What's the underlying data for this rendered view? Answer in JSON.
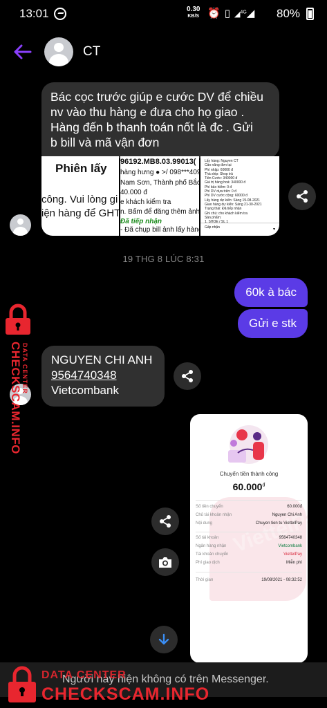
{
  "status_bar": {
    "time": "13:01",
    "net_speed_value": "0.30",
    "net_speed_unit": "KB/S",
    "signal_label": "4G",
    "battery": "80%"
  },
  "header": {
    "contact_name": "CT"
  },
  "messages": {
    "incoming_1": "Bác cọc trước giúp e cước DV để chiều\nnv vào thu hàng e đưa cho họ giao .\nHàng đến b thanh toán nốt là đc . Gửi\nb bill và mã vận đơn",
    "thumb1": {
      "title": "Phiên lấy",
      "line1": "công. Vui lòng gi",
      "line2": "iện hàng để GHT"
    },
    "thumb2": {
      "lines": [
        "96192.MB8.03.99013(",
        "hàng hưng ● >/ 098***4090",
        "Nam Sơn, Thành phố Bắc Nin",
        "40.000 đ",
        "e khách kiểm tra",
        "n. Bấm để đăng thêm ảnh!!!",
        "Đã tiếp nhận",
        "- Đã chụp bill ảnh lấy hàng."
      ]
    },
    "thumb3": {
      "text": "Lấy hàng: Nguyen CT\nCần nâng đơn tại\nPhí nhập: 60000 đ\nThà ship: Shop trả\nTiền Cước: 340000 đ\nGiá trị hàng hoá: 340000 đ\nPhí bảo hiểm: 0 đ\nPhí DV dựa trên: 0 đ\nPhí DV cước cộng: 60000 đ\nLấy hàng dự kiến: Sáng 19-08-2021\nGiao hàng dự kiến: Sáng 21-30-2021\nTrạng thái: Đã tiếp nhận\nGhi chú: cho khách kiểm tra\nSản phẩm:\n1. SHOE / SL 1",
      "bar": "Gấp nhận"
    },
    "timestamp": "19 THG 8 LÚC 8:31",
    "outgoing_1": "60k à bác",
    "outgoing_2": "Gửi e stk",
    "incoming_2": {
      "name": "NGUYEN CHI ANH",
      "account": "9564740348",
      "bank": "Vietcombank"
    }
  },
  "receipt": {
    "title": "Chuyển tiền thành công",
    "amount": "60.000",
    "currency": "đ",
    "watermark": "ViettelPay",
    "rows": [
      {
        "key": "Số tiền chuyển",
        "value": "60.000đ"
      },
      {
        "key": "Chủ tài khoản nhận",
        "value": "Nguyen Chi Anh"
      },
      {
        "key": "Nội dung",
        "value": "Chuyen tien tu ViettelPay"
      },
      {
        "key": "Số tài khoản",
        "value": "9564740348"
      },
      {
        "key": "Ngân hàng nhận",
        "value": "Vietcombank"
      },
      {
        "key": "Tài khoản chuyển",
        "value": "ViettelPay"
      },
      {
        "key": "Phí giao dịch",
        "value": "Miễn phí"
      },
      {
        "key": "Thời gian",
        "value": "19/08/2021 - 08:32:52"
      }
    ]
  },
  "banner": {
    "text": "Người này hiện không có trên Messenger."
  },
  "watermark": {
    "data_center": "DATA CENTER",
    "site": "CHECKSCAM.INFO"
  },
  "colors": {
    "accent": "#5b3be6",
    "incoming_bubble": "#303030",
    "watermark_red": "#e8262f"
  }
}
